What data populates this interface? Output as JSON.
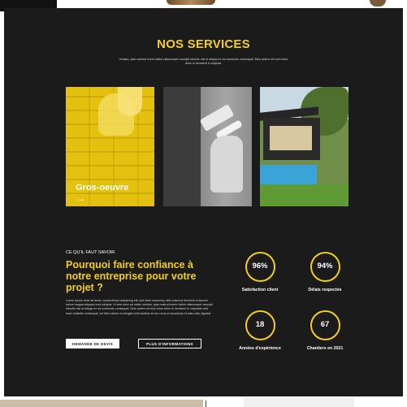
{
  "services": {
    "title": "NOS SERVICES",
    "subtitle": "Veniam, quis nostrud exerci tation ullamcorper suscipit lobortis nisl ut aliquip ex ea commodo consequat. Duis autem vel eum iriure dolor in hendrerit in vulputat.",
    "cards": [
      {
        "title": "Gros-oeuvre",
        "arrow": "→",
        "image": "bricklaying-photo"
      },
      {
        "image": "paint-brush-photo"
      },
      {
        "image": "modern-house-photo"
      }
    ]
  },
  "why": {
    "eyebrow": "CE QU'IL FAUT SAVOIR",
    "title": "Pourquoi faire confiance à notre entreprise pour votre projet ?",
    "text": "Lorem ipsum dolor sit amet, consectetuer adipiscing elit, sed diam nonummy nibh euismod tincidunt ut laoreet dolore magna aliquam erat volutpat. Ut wisi enim ad minim veniam, quis nostrud exerci tation ullamcorper suscipit lobortis nisl ut aliquip ex ea commodo consequat. Duis autem vel eum iriure dolor in hendrerit in vulputate velit esse molestie consequat, vel illum dolore eu feugiat nulla facilisis at vero eros et accumsan et iusto odio dignissi.",
    "buttons": {
      "quote": "DEMANDE DE DEVIS",
      "info": "PLUS D'INFORMATIONS"
    }
  },
  "stats": [
    {
      "value": "96%",
      "label": "Satisfaction client"
    },
    {
      "value": "94%",
      "label": "Délais respectés"
    },
    {
      "value": "18",
      "label": "Années d'expérience"
    },
    {
      "value": "67",
      "label": "Chantiers en 2021"
    }
  ],
  "colors": {
    "accent": "#f2cf1b",
    "background": "#1b1b1b",
    "text": "#ffffff"
  }
}
